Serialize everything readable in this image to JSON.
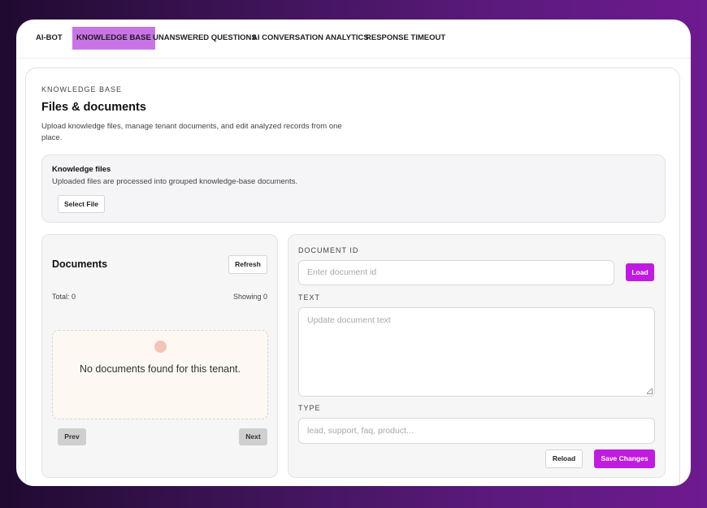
{
  "tabs": [
    {
      "label": "AI-BOT",
      "active": false
    },
    {
      "label": "KNOWLEDGE BASE",
      "active": true
    },
    {
      "label": "UNANSWERED QUESTIONS",
      "active": false
    },
    {
      "label": "AI CONVERSATION ANALYTICS",
      "active": false
    },
    {
      "label": "RESPONSE TIMEOUT",
      "active": false
    }
  ],
  "header": {
    "eyebrow": "KNOWLEDGE BASE",
    "title": "Files & documents",
    "description": "Upload knowledge files, manage tenant documents, and edit analyzed records from one place."
  },
  "knowledge_files": {
    "title": "Knowledge files",
    "subtitle": "Uploaded files are processed into grouped knowledge-base documents.",
    "select_button": "Select File"
  },
  "documents": {
    "title": "Documents",
    "refresh_button": "Refresh",
    "total": "Total: 0",
    "showing": "Showing 0",
    "empty_message": "No documents found for this tenant.",
    "prev_button": "Prev",
    "next_button": "Next"
  },
  "editor": {
    "document_id_label": "DOCUMENT ID",
    "document_id_placeholder": "Enter document id",
    "load_button": "Load",
    "text_label": "TEXT",
    "text_placeholder": "Update document text",
    "type_label": "TYPE",
    "type_placeholder": "lead, support, faq, product...",
    "reload_button": "Reload",
    "save_button": "Save Changes"
  },
  "colors": {
    "accent": "#c01be0",
    "active_tab": "#c974e6",
    "empty_indicator": "#f6c3b7"
  }
}
